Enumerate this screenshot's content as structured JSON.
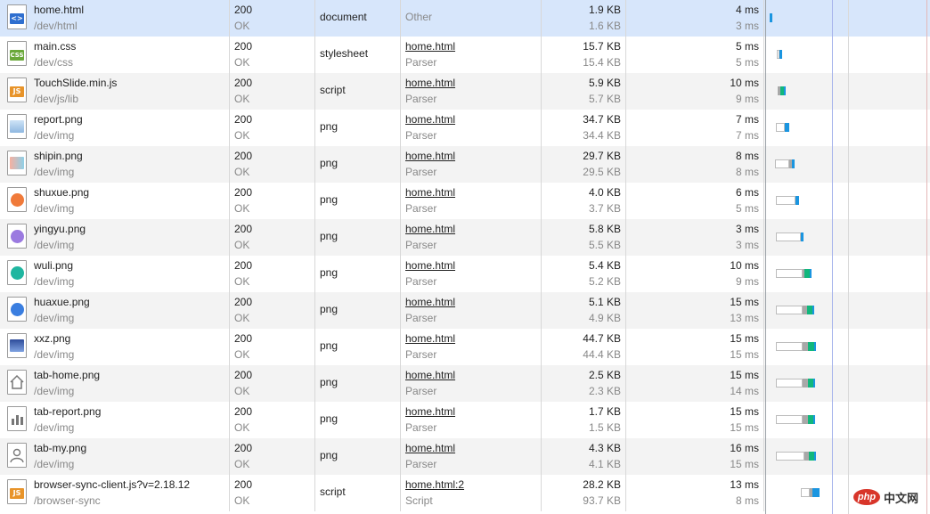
{
  "rows": [
    {
      "name": "home.html",
      "path": "/dev/html",
      "status": "200",
      "status_text": "OK",
      "type": "document",
      "initiator": "Other",
      "initiator_sub": "",
      "size": "1.9 KB",
      "content": "1.6 KB",
      "time": "4 ms",
      "latency": "3 ms",
      "icon": "html-file-icon",
      "selected": true
    },
    {
      "name": "main.css",
      "path": "/dev/css",
      "status": "200",
      "status_text": "OK",
      "type": "stylesheet",
      "initiator": "home.html",
      "initiator_sub": "Parser",
      "size": "15.7 KB",
      "content": "15.4 KB",
      "time": "5 ms",
      "latency": "5 ms",
      "icon": "css-file-icon"
    },
    {
      "name": "TouchSlide.min.js",
      "path": "/dev/js/lib",
      "status": "200",
      "status_text": "OK",
      "type": "script",
      "initiator": "home.html",
      "initiator_sub": "Parser",
      "size": "5.9 KB",
      "content": "5.7 KB",
      "time": "10 ms",
      "latency": "9 ms",
      "icon": "js-file-icon"
    },
    {
      "name": "report.png",
      "path": "/dev/img",
      "status": "200",
      "status_text": "OK",
      "type": "png",
      "initiator": "home.html",
      "initiator_sub": "Parser",
      "size": "34.7 KB",
      "content": "34.4 KB",
      "time": "7 ms",
      "latency": "7 ms",
      "icon": "report-image-icon"
    },
    {
      "name": "shipin.png",
      "path": "/dev/img",
      "status": "200",
      "status_text": "OK",
      "type": "png",
      "initiator": "home.html",
      "initiator_sub": "Parser",
      "size": "29.7 KB",
      "content": "29.5 KB",
      "time": "8 ms",
      "latency": "8 ms",
      "icon": "shipin-image-icon"
    },
    {
      "name": "shuxue.png",
      "path": "/dev/img",
      "status": "200",
      "status_text": "OK",
      "type": "png",
      "initiator": "home.html",
      "initiator_sub": "Parser",
      "size": "4.0 KB",
      "content": "3.7 KB",
      "time": "6 ms",
      "latency": "5 ms",
      "icon": "shuxue-image-icon"
    },
    {
      "name": "yingyu.png",
      "path": "/dev/img",
      "status": "200",
      "status_text": "OK",
      "type": "png",
      "initiator": "home.html",
      "initiator_sub": "Parser",
      "size": "5.8 KB",
      "content": "5.5 KB",
      "time": "3 ms",
      "latency": "3 ms",
      "icon": "yingyu-image-icon"
    },
    {
      "name": "wuli.png",
      "path": "/dev/img",
      "status": "200",
      "status_text": "OK",
      "type": "png",
      "initiator": "home.html",
      "initiator_sub": "Parser",
      "size": "5.4 KB",
      "content": "5.2 KB",
      "time": "10 ms",
      "latency": "9 ms",
      "icon": "wuli-image-icon"
    },
    {
      "name": "huaxue.png",
      "path": "/dev/img",
      "status": "200",
      "status_text": "OK",
      "type": "png",
      "initiator": "home.html",
      "initiator_sub": "Parser",
      "size": "5.1 KB",
      "content": "4.9 KB",
      "time": "15 ms",
      "latency": "13 ms",
      "icon": "huaxue-image-icon"
    },
    {
      "name": "xxz.png",
      "path": "/dev/img",
      "status": "200",
      "status_text": "OK",
      "type": "png",
      "initiator": "home.html",
      "initiator_sub": "Parser",
      "size": "44.7 KB",
      "content": "44.4 KB",
      "time": "15 ms",
      "latency": "15 ms",
      "icon": "xxz-image-icon"
    },
    {
      "name": "tab-home.png",
      "path": "/dev/img",
      "status": "200",
      "status_text": "OK",
      "type": "png",
      "initiator": "home.html",
      "initiator_sub": "Parser",
      "size": "2.5 KB",
      "content": "2.3 KB",
      "time": "15 ms",
      "latency": "14 ms",
      "icon": "home-icon"
    },
    {
      "name": "tab-report.png",
      "path": "/dev/img",
      "status": "200",
      "status_text": "OK",
      "type": "png",
      "initiator": "home.html",
      "initiator_sub": "Parser",
      "size": "1.7 KB",
      "content": "1.5 KB",
      "time": "15 ms",
      "latency": "15 ms",
      "icon": "bar-chart-icon"
    },
    {
      "name": "tab-my.png",
      "path": "/dev/img",
      "status": "200",
      "status_text": "OK",
      "type": "png",
      "initiator": "home.html",
      "initiator_sub": "Parser",
      "size": "4.3 KB",
      "content": "4.1 KB",
      "time": "16 ms",
      "latency": "15 ms",
      "icon": "user-icon"
    },
    {
      "name": "browser-sync-client.js?v=2.18.12",
      "path": "/browser-sync",
      "status": "200",
      "status_text": "OK",
      "type": "script",
      "initiator": "home.html:2",
      "initiator_sub": "Script",
      "size": "28.2 KB",
      "content": "93.7 KB",
      "time": "13 ms",
      "latency": "8 ms",
      "icon": "js-file-icon"
    }
  ],
  "watermark": {
    "logo": "php",
    "text": "中文网"
  },
  "colors": {
    "selected_row": "#d7e6fb",
    "stripe_row": "#f3f3f3",
    "waterfall_green": "#11b77c",
    "waterfall_blue": "#1a95e0"
  }
}
